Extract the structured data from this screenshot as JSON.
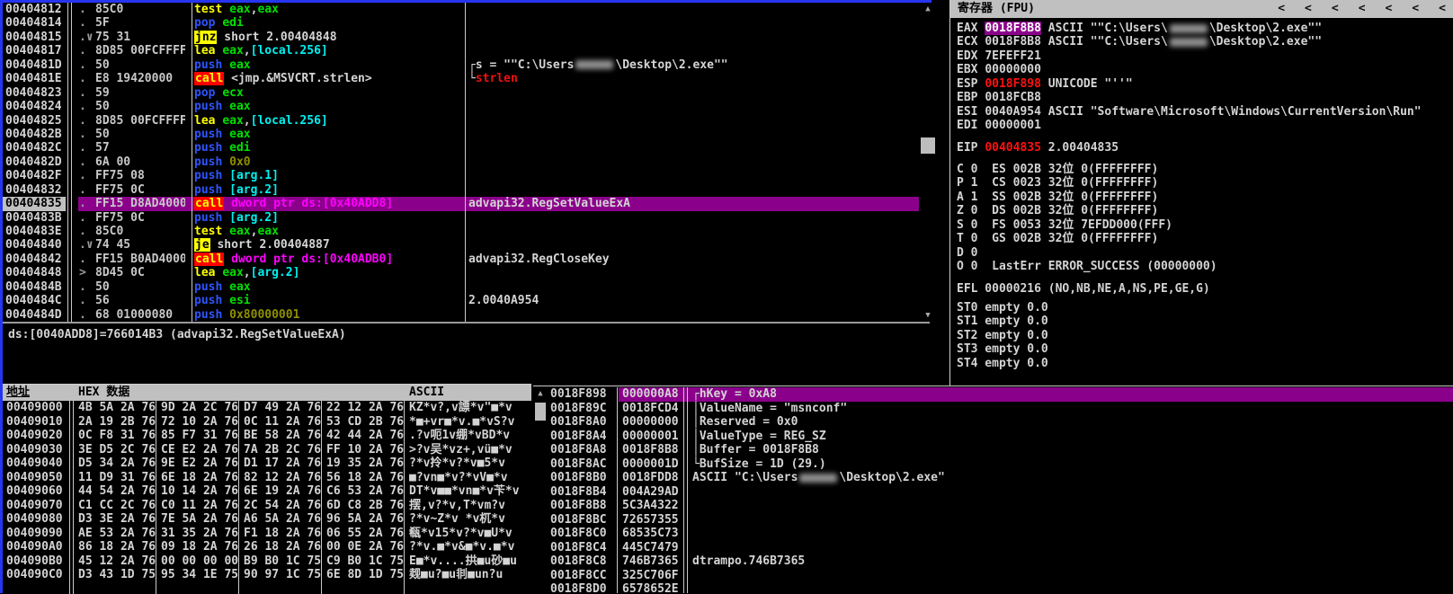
{
  "info": {
    "text": "ds:[0040ADD8]=766014B3 (advapi32.RegSetValueExA)"
  },
  "disasm": {
    "rows": [
      {
        "addr": "00404812",
        "mark": ".",
        "bytes": "85C0",
        "instr": [
          [
            "mn",
            "test"
          ],
          [
            "tx",
            " "
          ],
          [
            "rg",
            "eax"
          ],
          [
            "tx",
            ","
          ],
          [
            "rg",
            "eax"
          ]
        ]
      },
      {
        "addr": "00404814",
        "mark": ".",
        "bytes": "5F",
        "instr": [
          [
            "bl",
            "pop"
          ],
          [
            "tx",
            " "
          ],
          [
            "rg",
            "edi"
          ]
        ]
      },
      {
        "addr": "00404815",
        "mark": ".∨",
        "bytes": "75 31",
        "instr": [
          [
            "jy",
            "jnz"
          ],
          [
            "tx",
            " short 2.00404848"
          ]
        ]
      },
      {
        "addr": "00404817",
        "mark": ".",
        "bytes": "8D85 00FCFFFF",
        "instr": [
          [
            "mn",
            "lea"
          ],
          [
            "tx",
            " "
          ],
          [
            "rg",
            "eax"
          ],
          [
            "tx",
            ","
          ],
          [
            "me",
            "[local.256]"
          ]
        ]
      },
      {
        "addr": "0040481D",
        "mark": ".",
        "bytes": "50",
        "instr": [
          [
            "bl",
            "push"
          ],
          [
            "tx",
            " "
          ],
          [
            "rg",
            "eax"
          ]
        ],
        "cmt": [
          [
            "tx",
            "┌s = \"\"C:\\Users"
          ],
          [
            "blur",
            ""
          ],
          [
            "tx",
            "\\Desktop\\2.exe\"\""
          ]
        ]
      },
      {
        "addr": "0040481E",
        "mark": ".",
        "bytes": "E8 19420000",
        "instr": [
          [
            "cr",
            "call"
          ],
          [
            "tx",
            " <jmp.&MSVCRT.strlen>"
          ]
        ],
        "cmt": [
          [
            "tx",
            "└"
          ],
          [
            "rd",
            "strlen"
          ]
        ]
      },
      {
        "addr": "00404823",
        "mark": ".",
        "bytes": "59",
        "instr": [
          [
            "bl",
            "pop"
          ],
          [
            "tx",
            " "
          ],
          [
            "rg",
            "ecx"
          ]
        ]
      },
      {
        "addr": "00404824",
        "mark": ".",
        "bytes": "50",
        "instr": [
          [
            "bl",
            "push"
          ],
          [
            "tx",
            " "
          ],
          [
            "rg",
            "eax"
          ]
        ]
      },
      {
        "addr": "00404825",
        "mark": ".",
        "bytes": "8D85 00FCFFFF",
        "instr": [
          [
            "mn",
            "lea"
          ],
          [
            "tx",
            " "
          ],
          [
            "rg",
            "eax"
          ],
          [
            "tx",
            ","
          ],
          [
            "me",
            "[local.256]"
          ]
        ]
      },
      {
        "addr": "0040482B",
        "mark": ".",
        "bytes": "50",
        "instr": [
          [
            "bl",
            "push"
          ],
          [
            "tx",
            " "
          ],
          [
            "rg",
            "eax"
          ]
        ]
      },
      {
        "addr": "0040482C",
        "mark": ".",
        "bytes": "57",
        "instr": [
          [
            "bl",
            "push"
          ],
          [
            "tx",
            " "
          ],
          [
            "rg",
            "edi"
          ]
        ]
      },
      {
        "addr": "0040482D",
        "mark": ".",
        "bytes": "6A 00",
        "instr": [
          [
            "bl",
            "push"
          ],
          [
            "tx",
            " "
          ],
          [
            "im",
            "0x0"
          ]
        ]
      },
      {
        "addr": "0040482F",
        "mark": ".",
        "bytes": "FF75 08",
        "instr": [
          [
            "bl",
            "push"
          ],
          [
            "tx",
            " "
          ],
          [
            "me",
            "[arg.1]"
          ]
        ]
      },
      {
        "addr": "00404832",
        "mark": ".",
        "bytes": "FF75 0C",
        "instr": [
          [
            "bl",
            "push"
          ],
          [
            "tx",
            " "
          ],
          [
            "me",
            "[arg.2]"
          ]
        ]
      },
      {
        "addr": "00404835",
        "mark": ".",
        "bytes": "FF15 D8AD4000",
        "sel": true,
        "instr": [
          [
            "cr",
            "call"
          ],
          [
            "tx",
            " "
          ],
          [
            "pt",
            "dword ptr ds:[0x40ADD8]"
          ]
        ],
        "cmt": [
          [
            "tx",
            "advapi32.RegSetValueExA"
          ]
        ]
      },
      {
        "addr": "0040483B",
        "mark": ".",
        "bytes": "FF75 0C",
        "instr": [
          [
            "bl",
            "push"
          ],
          [
            "tx",
            " "
          ],
          [
            "me",
            "[arg.2]"
          ]
        ]
      },
      {
        "addr": "0040483E",
        "mark": ".",
        "bytes": "85C0",
        "instr": [
          [
            "mn",
            "test"
          ],
          [
            "tx",
            " "
          ],
          [
            "rg",
            "eax"
          ],
          [
            "tx",
            ","
          ],
          [
            "rg",
            "eax"
          ]
        ]
      },
      {
        "addr": "00404840",
        "mark": ".∨",
        "bytes": "74 45",
        "instr": [
          [
            "jy",
            "je"
          ],
          [
            "tx",
            " short 2.00404887"
          ]
        ]
      },
      {
        "addr": "00404842",
        "mark": ".",
        "bytes": "FF15 B0AD4000",
        "instr": [
          [
            "cr",
            "call"
          ],
          [
            "tx",
            " "
          ],
          [
            "pt",
            "dword ptr ds:[0x40ADB0]"
          ]
        ],
        "cmt": [
          [
            "tx",
            "advapi32.RegCloseKey"
          ]
        ]
      },
      {
        "addr": "00404848",
        "mark": ">",
        "bytes": "8D45 0C",
        "instr": [
          [
            "mn",
            "lea"
          ],
          [
            "tx",
            " "
          ],
          [
            "rg",
            "eax"
          ],
          [
            "tx",
            ","
          ],
          [
            "me",
            "[arg.2]"
          ]
        ]
      },
      {
        "addr": "0040484B",
        "mark": ".",
        "bytes": "50",
        "instr": [
          [
            "bl",
            "push"
          ],
          [
            "tx",
            " "
          ],
          [
            "rg",
            "eax"
          ]
        ]
      },
      {
        "addr": "0040484C",
        "mark": ".",
        "bytes": "56",
        "instr": [
          [
            "bl",
            "push"
          ],
          [
            "tx",
            " "
          ],
          [
            "rg",
            "esi"
          ]
        ],
        "cmt": [
          [
            "tx",
            "2.0040A954"
          ]
        ]
      },
      {
        "addr": "0040484D",
        "mark": ".",
        "bytes": "68 01000080",
        "instr": [
          [
            "bl",
            "push"
          ],
          [
            "tx",
            " "
          ],
          [
            "im",
            "0x80000001"
          ]
        ]
      }
    ]
  },
  "registers": {
    "title": "寄存器 (FPU)",
    "chevrons": [
      "<",
      "<",
      "<",
      "<",
      "<",
      "<",
      "<"
    ],
    "general": [
      {
        "name": "EAX",
        "value": "0018F8B8",
        "vcls": "hl",
        "desc": [
          [
            "tx",
            "ASCII \"\"C:\\Users\\"
          ],
          [
            "blur",
            ""
          ],
          [
            "tx",
            "\\Desktop\\2.exe\"\""
          ]
        ]
      },
      {
        "name": "ECX",
        "value": "0018F8B8",
        "vcls": "",
        "desc": [
          [
            "tx",
            "ASCII \"\"C:\\Users\\"
          ],
          [
            "blur",
            ""
          ],
          [
            "tx",
            "\\Desktop\\2.exe\"\""
          ]
        ]
      },
      {
        "name": "EDX",
        "value": "7EFEFF21",
        "vcls": "",
        "desc": []
      },
      {
        "name": "EBX",
        "value": "00000000",
        "vcls": "",
        "desc": []
      },
      {
        "name": "ESP",
        "value": "0018F898",
        "vcls": "rd",
        "desc": [
          [
            "tx",
            "UNICODE \"''\""
          ]
        ]
      },
      {
        "name": "EBP",
        "value": "0018FCB8",
        "vcls": "",
        "desc": []
      },
      {
        "name": "ESI",
        "value": "0040A954",
        "vcls": "",
        "desc": [
          [
            "tx",
            "ASCII \"Software\\Microsoft\\Windows\\CurrentVersion\\Run\""
          ]
        ]
      },
      {
        "name": "EDI",
        "value": "00000001",
        "vcls": "",
        "desc": []
      }
    ],
    "eip": {
      "name": "EIP",
      "value": "00404835",
      "vcls": "rd",
      "desc": [
        [
          "tx",
          "2.00404835"
        ]
      ]
    },
    "flags": [
      "C 0  ES 002B 32位 0(FFFFFFFF)",
      "P 1  CS 0023 32位 0(FFFFFFFF)",
      "A 1  SS 002B 32位 0(FFFFFFFF)",
      "Z 0  DS 002B 32位 0(FFFFFFFF)",
      "S 0  FS 0053 32位 7EFDD000(FFF)",
      "T 0  GS 002B 32位 0(FFFFFFFF)",
      "D 0",
      "O 0  LastErr ERROR_SUCCESS (00000000)"
    ],
    "efl": "EFL 00000216 (NO,NB,NE,A,NS,PE,GE,G)",
    "fpu": [
      "ST0 empty 0.0",
      "ST1 empty 0.0",
      "ST2 empty 0.0",
      "ST3 empty 0.0",
      "ST4 empty 0.0"
    ]
  },
  "dump": {
    "headers": {
      "address": "地址",
      "hex": "HEX 数据",
      "ascii": "ASCII"
    },
    "rows": [
      {
        "addr": "00409000",
        "groups": [
          "4B 5A 2A 76",
          "9D 2A 2C 76",
          "D7 49 2A 76",
          "22 12 2A 76"
        ],
        "ascii": "KZ*v?,v謤*v\"■*v"
      },
      {
        "addr": "00409010",
        "groups": [
          "2A 19 2B 76",
          "72 10 2A 76",
          "0C 11 2A 76",
          "53 CD 2B 76"
        ],
        "ascii": "*■+vr■*v.■*vS?v"
      },
      {
        "addr": "00409020",
        "groups": [
          "0C F8 31 76",
          "85 F7 31 76",
          "BE 58 2A 76",
          "42 44 2A 76"
        ],
        "ascii": ".?v呃1v绷*vBD*v"
      },
      {
        "addr": "00409030",
        "groups": [
          "3E D5 2C 76",
          "CE E2 2A 76",
          "7A 2B 2C 76",
          "FF 10 2A 76"
        ],
        "ascii": ">?v吴*vz+,vü■*v"
      },
      {
        "addr": "00409040",
        "groups": [
          "D5 34 2A 76",
          "9E E2 2A 76",
          "D1 17 2A 76",
          "19 35 2A 76"
        ],
        "ascii": "?*v拎*v?*v■5*v"
      },
      {
        "addr": "00409050",
        "groups": [
          "11 D9 31 76",
          "6E 18 2A 76",
          "82 12 2A 76",
          "56 18 2A 76"
        ],
        "ascii": "■?vn■*v?*vV■*v"
      },
      {
        "addr": "00409060",
        "groups": [
          "44 54 2A 76",
          "10 14 2A 76",
          "6E 19 2A 76",
          "C6 53 2A 76"
        ],
        "ascii": "DT*v■■*vn■*v苄*v"
      },
      {
        "addr": "00409070",
        "groups": [
          "C1 CC 2C 76",
          "C0 11 2A 76",
          "2C 54 2A 76",
          "6D C8 2B 76"
        ],
        "ascii": "摆,v?*v,T*vm?v"
      },
      {
        "addr": "00409080",
        "groups": [
          "D3 3E 2A 76",
          "7E 5A 2A 76",
          "A6 5A 2A 76",
          "96 5A 2A 76"
        ],
        "ascii": "?*v~Z*v *v杌*v"
      },
      {
        "addr": "00409090",
        "groups": [
          "AE 53 2A 76",
          "31 35 2A 76",
          "F1 18 2A 76",
          "06 55 2A 76"
        ],
        "ascii": "瓻*v15*v?*v■U*v"
      },
      {
        "addr": "004090A0",
        "groups": [
          "86 18 2A 76",
          "09 18 2A 76",
          "26 18 2A 76",
          "00 0E 2A 76"
        ],
        "ascii": "?*v.■*v&■*v.■*v"
      },
      {
        "addr": "004090B0",
        "groups": [
          "45 12 2A 76",
          "00 00 00 00",
          "B9 B0 1C 75",
          "C9 B0 1C 75"
        ],
        "ascii": "E■*v....拱■u砂■u"
      },
      {
        "addr": "004090C0",
        "groups": [
          "D3 43 1D 75",
          "95 34 1E 75",
          "90 97 1C 75",
          "6E 8D 1D 75"
        ],
        "ascii": "觌■u?■u剕■un?u"
      }
    ]
  },
  "stack": {
    "rows": [
      {
        "addr": "0018F898",
        "val": "000000A8",
        "sel": true,
        "cmt": [
          [
            "tx",
            "┌hKey = 0xA8"
          ]
        ]
      },
      {
        "addr": "0018F89C",
        "val": "0018FCD4",
        "cmt": [
          [
            "tx",
            "│ValueName = \"msnconf\""
          ]
        ]
      },
      {
        "addr": "0018F8A0",
        "val": "00000000",
        "cmt": [
          [
            "tx",
            "│Reserved = 0x0"
          ]
        ]
      },
      {
        "addr": "0018F8A4",
        "val": "00000001",
        "cmt": [
          [
            "tx",
            "│ValueType = REG_SZ"
          ]
        ]
      },
      {
        "addr": "0018F8A8",
        "val": "0018F8B8",
        "cmt": [
          [
            "tx",
            "│Buffer = 0018F8B8"
          ]
        ]
      },
      {
        "addr": "0018F8AC",
        "val": "0000001D",
        "cmt": [
          [
            "tx",
            "└BufSize = 1D (29.)"
          ]
        ]
      },
      {
        "addr": "0018F8B0",
        "val": "0018FDD8",
        "cmt": [
          [
            "tx",
            "ASCII \"C:\\Users"
          ],
          [
            "blur",
            ""
          ],
          [
            "tx",
            "\\Desktop\\2.exe\""
          ]
        ]
      },
      {
        "addr": "0018F8B4",
        "val": "004A29AD"
      },
      {
        "addr": "0018F8B8",
        "val": "5C3A4322"
      },
      {
        "addr": "0018F8BC",
        "val": "72657355"
      },
      {
        "addr": "0018F8C0",
        "val": "68535C73"
      },
      {
        "addr": "0018F8C4",
        "val": "445C7479"
      },
      {
        "addr": "0018F8C8",
        "val": "746B7365",
        "cmt": [
          [
            "tx",
            "dtrampo.746B7365"
          ]
        ]
      },
      {
        "addr": "0018F8CC",
        "val": "325C706F"
      },
      {
        "addr": "0018F8D0",
        "val": "6578652E"
      }
    ]
  },
  "colors": {
    "selection_purple": "#8B008B",
    "call_bg": "#FF0000",
    "jump_bg": "#FFFF00",
    "mnemonic": "#FFFF00",
    "stack_op_blue": "#2E55FF",
    "register_green": "#00E000",
    "memory_cyan": "#00F0F0",
    "immediate_olive": "#8F8F00",
    "pointer_magenta": "#FF00FF",
    "red_value": "#FF1010",
    "window_border_blue": "#2636F0",
    "ui_gray": "#C0C0C0"
  }
}
